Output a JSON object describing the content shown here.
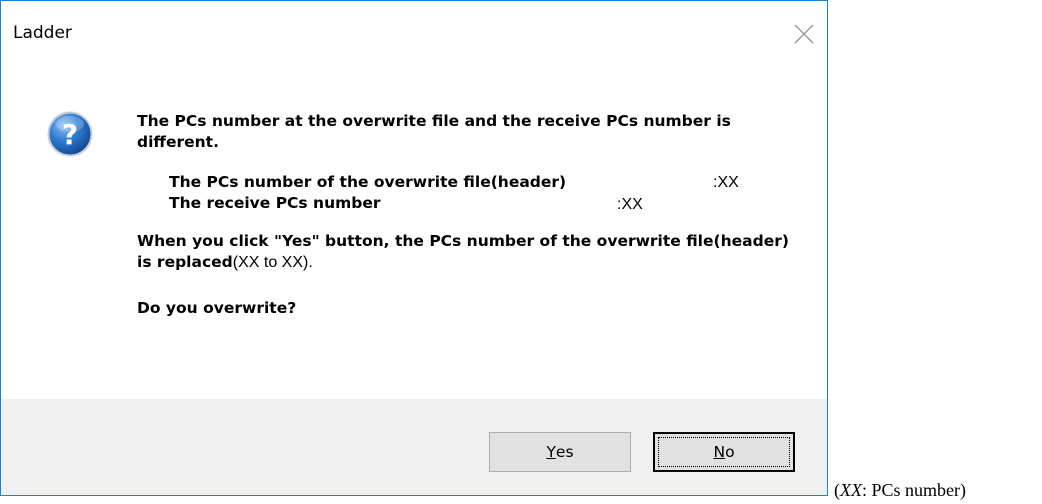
{
  "window": {
    "title": "Ladder",
    "close_icon": "close-icon",
    "border_color": "#1883d7"
  },
  "message": {
    "icon": "question-icon",
    "line1": "The PCs number at the overwrite file and the receive PCs number is different.",
    "detail1_label": "The PCs number of the overwrite file(header)",
    "detail1_value": ":XX",
    "detail2_label": "The receive PCs number",
    "detail2_value": ":XX",
    "line3_bold": "When you click \"Yes\" button, the PCs number of the overwrite file(header) is replaced",
    "line3_normal": "(XX to XX).",
    "question": "Do you overwrite?"
  },
  "buttons": {
    "yes_mnemonic": "Y",
    "yes_rest": "es",
    "no_mnemonic": "N",
    "no_rest": "o"
  },
  "caption": {
    "open": "(",
    "italic": "XX",
    "rest": ": PCs number)"
  }
}
